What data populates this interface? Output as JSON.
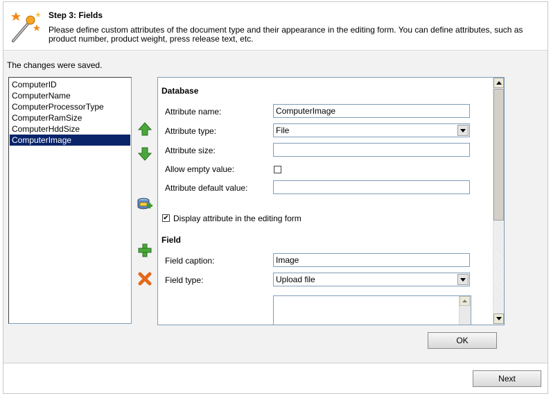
{
  "header": {
    "title": "Step 3: Fields",
    "description": "Please define custom attributes of the document type and their appearance in the editing form. You can define attributes, such as product number, product weight, press release text, etc."
  },
  "status": {
    "message": "The changes were saved."
  },
  "attributes": {
    "items": [
      {
        "label": "ComputerID"
      },
      {
        "label": "ComputerName"
      },
      {
        "label": "ComputerProcessorType"
      },
      {
        "label": "ComputerRamSize"
      },
      {
        "label": "ComputerHddSize"
      },
      {
        "label": "ComputerImage"
      }
    ],
    "selected": "ComputerImage"
  },
  "side_buttons": [
    "move-up-icon",
    "move-down-icon",
    "add-system-field-icon",
    "add-attribute-icon",
    "delete-attribute-icon"
  ],
  "database": {
    "section_title": "Database",
    "attribute_name_label": "Attribute name:",
    "attribute_name_value": "ComputerImage",
    "attribute_type_label": "Attribute type:",
    "attribute_type_value": "File",
    "attribute_size_label": "Attribute size:",
    "attribute_size_value": "",
    "allow_empty_label": "Allow empty value:",
    "allow_empty_checked": false,
    "default_value_label": "Attribute default value:",
    "default_value_value": ""
  },
  "display_in_form": {
    "label": "Display attribute in the editing form",
    "checked": true
  },
  "field": {
    "section_title": "Field",
    "caption_label": "Field caption:",
    "caption_value": "Image",
    "type_label": "Field type:",
    "type_value": "Upload file"
  },
  "buttons": {
    "ok": "OK",
    "next": "Next"
  },
  "colors": {
    "selection": "#0a246a",
    "add_green": "#3a9a2a",
    "delete_orange": "#e26a1c"
  }
}
